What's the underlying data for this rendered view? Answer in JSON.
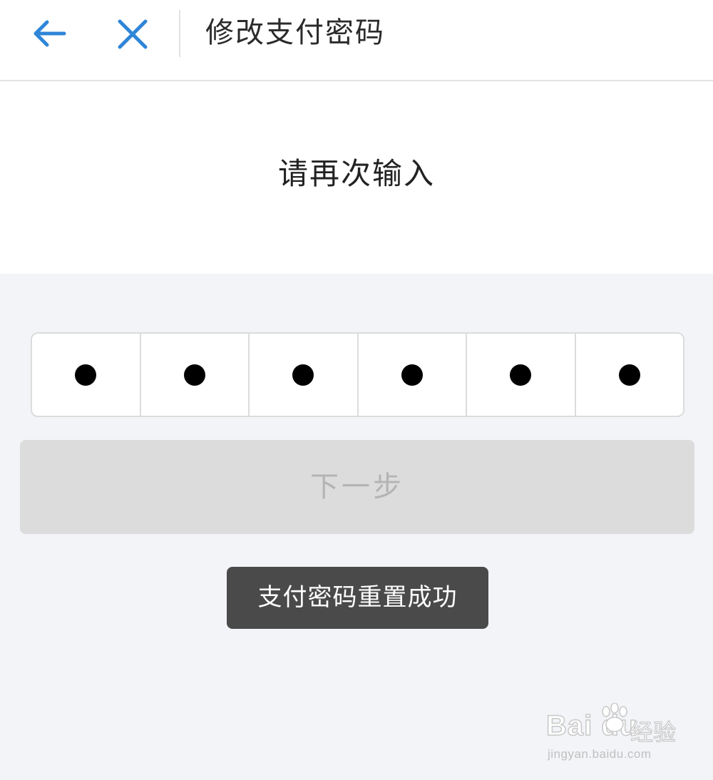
{
  "header": {
    "title": "修改支付密码",
    "back_icon": "arrow-left-icon",
    "close_icon": "close-icon",
    "accent_color": "#2f86d8"
  },
  "prompt": {
    "text": "请再次输入"
  },
  "pin": {
    "length": 6,
    "filled": 6
  },
  "next_button": {
    "label": "下一步",
    "enabled": false
  },
  "toast": {
    "message": "支付密码重置成功"
  },
  "watermark": {
    "logo": "Bai du",
    "brand_cn": "经验",
    "url": "jingyan.baidu.com"
  }
}
